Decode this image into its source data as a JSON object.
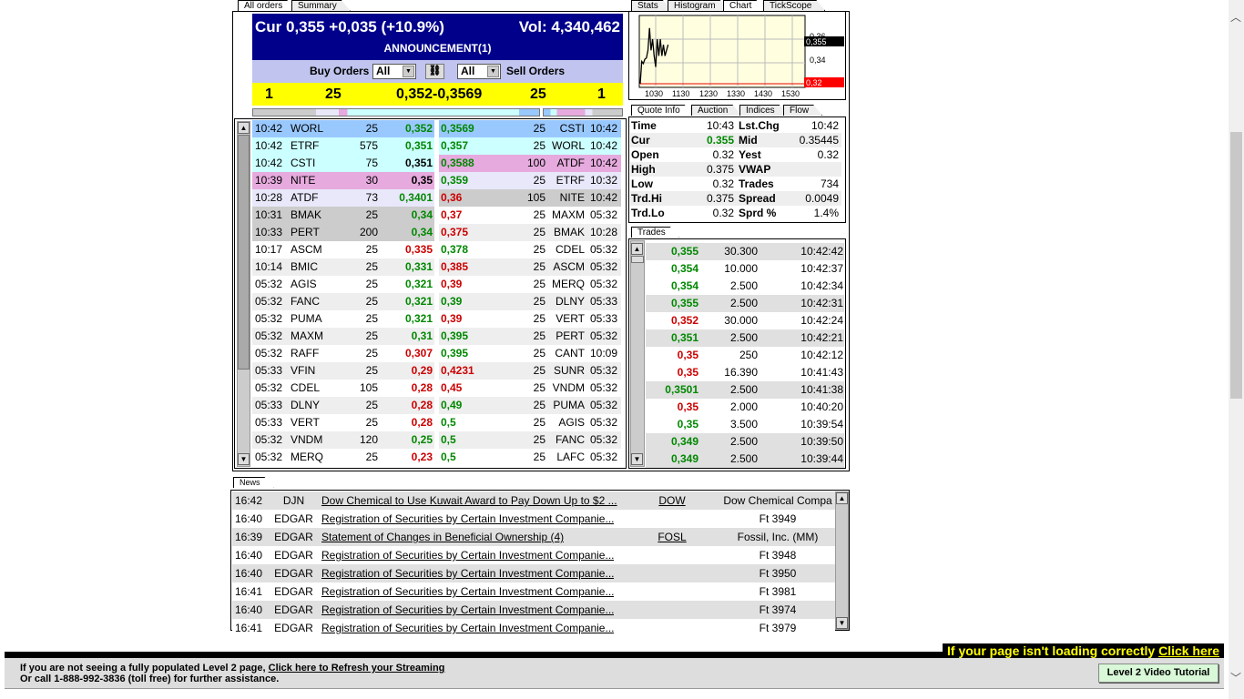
{
  "tabs_left": [
    "All orders",
    "Summary"
  ],
  "tabs_chart": [
    "Stats",
    "Histogram",
    "Chart",
    "TickScope"
  ],
  "tabs_quote": [
    "Quote Info",
    "Auction",
    "Indices",
    "Flow"
  ],
  "tabs_trades": [
    "Trades"
  ],
  "tabs_news": [
    "News"
  ],
  "header": {
    "cur": "Cur 0,355 +0,035 (+10.9%)",
    "vol": "Vol: 4,340,462",
    "announcement": "ANNOUNCEMENT(1)"
  },
  "controls": {
    "buy_label": "Buy Orders",
    "buy_filter": "All",
    "sell_filter": "All",
    "sell_label": "Sell Orders"
  },
  "summary": {
    "bid_count": "1",
    "bid_size": "25",
    "spread": "0,352-0,3569",
    "ask_size": "25",
    "ask_count": "1"
  },
  "book": [
    {
      "bt": "10:42",
      "bm": "WORL",
      "bs": "25",
      "bp": "0,352",
      "bc": "g",
      "bbg": "#99c8ff",
      "ap": "0,3569",
      "ac": "g",
      "as": "25",
      "am": "CSTI",
      "at": "10:42",
      "abg": "#99c8ff"
    },
    {
      "bt": "10:42",
      "bm": "ETRF",
      "bs": "575",
      "bp": "0,351",
      "bc": "g",
      "bbg": "#ccffff",
      "ap": "0,357",
      "ac": "g",
      "as": "25",
      "am": "WORL",
      "at": "10:42",
      "abg": "#ccffff"
    },
    {
      "bt": "10:42",
      "bm": "CSTI",
      "bs": "75",
      "bp": "0,351",
      "bc": "k",
      "bbg": "#ccffff",
      "ap": "0,3588",
      "ac": "g",
      "as": "100",
      "am": "ATDF",
      "at": "10:42",
      "abg": "#e6aade"
    },
    {
      "bt": "10:39",
      "bm": "NITE",
      "bs": "30",
      "bp": "0,35",
      "bc": "k",
      "bbg": "#e6aade",
      "ap": "0,359",
      "ac": "g",
      "as": "25",
      "am": "ETRF",
      "at": "10:32",
      "abg": "#e8e8fa"
    },
    {
      "bt": "10:28",
      "bm": "ATDF",
      "bs": "73",
      "bp": "0,3401",
      "bc": "g",
      "bbg": "#e8e8fa",
      "ap": "0,36",
      "ac": "r",
      "as": "105",
      "am": "NITE",
      "at": "10:42",
      "abg": "#cccccc"
    },
    {
      "bt": "10:31",
      "bm": "BMAK",
      "bs": "25",
      "bp": "0,34",
      "bc": "g",
      "bbg": "#cccccc",
      "ap": "0,37",
      "ac": "r",
      "as": "25",
      "am": "MAXM",
      "at": "05:32",
      "abg": "#ffffff"
    },
    {
      "bt": "10:33",
      "bm": "PERT",
      "bs": "200",
      "bp": "0,34",
      "bc": "g",
      "bbg": "#cccccc",
      "ap": "0,375",
      "ac": "r",
      "as": "25",
      "am": "BMAK",
      "at": "10:28",
      "abg": "#eeeeee"
    },
    {
      "bt": "10:17",
      "bm": "ASCM",
      "bs": "25",
      "bp": "0,335",
      "bc": "r",
      "bbg": "#ffffff",
      "ap": "0,378",
      "ac": "g",
      "as": "25",
      "am": "CDEL",
      "at": "05:32",
      "abg": "#ffffff"
    },
    {
      "bt": "10:14",
      "bm": "BMIC",
      "bs": "25",
      "bp": "0,331",
      "bc": "g",
      "bbg": "#eeeeee",
      "ap": "0,385",
      "ac": "r",
      "as": "25",
      "am": "ASCM",
      "at": "05:32",
      "abg": "#eeeeee"
    },
    {
      "bt": "05:32",
      "bm": "AGIS",
      "bs": "25",
      "bp": "0,321",
      "bc": "g",
      "bbg": "#ffffff",
      "ap": "0,39",
      "ac": "r",
      "as": "25",
      "am": "MERQ",
      "at": "05:32",
      "abg": "#ffffff"
    },
    {
      "bt": "05:32",
      "bm": "FANC",
      "bs": "25",
      "bp": "0,321",
      "bc": "g",
      "bbg": "#eeeeee",
      "ap": "0,39",
      "ac": "g",
      "as": "25",
      "am": "DLNY",
      "at": "05:33",
      "abg": "#eeeeee"
    },
    {
      "bt": "05:32",
      "bm": "PUMA",
      "bs": "25",
      "bp": "0,321",
      "bc": "g",
      "bbg": "#ffffff",
      "ap": "0,39",
      "ac": "r",
      "as": "25",
      "am": "VERT",
      "at": "05:33",
      "abg": "#ffffff"
    },
    {
      "bt": "05:32",
      "bm": "MAXM",
      "bs": "25",
      "bp": "0,31",
      "bc": "g",
      "bbg": "#eeeeee",
      "ap": "0,395",
      "ac": "g",
      "as": "25",
      "am": "PERT",
      "at": "05:32",
      "abg": "#eeeeee"
    },
    {
      "bt": "05:32",
      "bm": "RAFF",
      "bs": "25",
      "bp": "0,307",
      "bc": "r",
      "bbg": "#ffffff",
      "ap": "0,395",
      "ac": "g",
      "as": "25",
      "am": "CANT",
      "at": "10:09",
      "abg": "#ffffff"
    },
    {
      "bt": "05:33",
      "bm": "VFIN",
      "bs": "25",
      "bp": "0,29",
      "bc": "r",
      "bbg": "#eeeeee",
      "ap": "0,4231",
      "ac": "r",
      "as": "25",
      "am": "SUNR",
      "at": "05:32",
      "abg": "#eeeeee"
    },
    {
      "bt": "05:32",
      "bm": "CDEL",
      "bs": "105",
      "bp": "0,28",
      "bc": "r",
      "bbg": "#ffffff",
      "ap": "0,45",
      "ac": "r",
      "as": "25",
      "am": "VNDM",
      "at": "05:32",
      "abg": "#ffffff"
    },
    {
      "bt": "05:33",
      "bm": "DLNY",
      "bs": "25",
      "bp": "0,28",
      "bc": "r",
      "bbg": "#eeeeee",
      "ap": "0,49",
      "ac": "g",
      "as": "25",
      "am": "PUMA",
      "at": "05:32",
      "abg": "#eeeeee"
    },
    {
      "bt": "05:33",
      "bm": "VERT",
      "bs": "25",
      "bp": "0,28",
      "bc": "r",
      "bbg": "#ffffff",
      "ap": "0,5",
      "ac": "g",
      "as": "25",
      "am": "AGIS",
      "at": "05:32",
      "abg": "#ffffff"
    },
    {
      "bt": "05:32",
      "bm": "VNDM",
      "bs": "120",
      "bp": "0,25",
      "bc": "g",
      "bbg": "#eeeeee",
      "ap": "0,5",
      "ac": "g",
      "as": "25",
      "am": "FANC",
      "at": "05:32",
      "abg": "#eeeeee"
    },
    {
      "bt": "05:32",
      "bm": "MERQ",
      "bs": "25",
      "bp": "0,23",
      "bc": "r",
      "bbg": "#ffffff",
      "ap": "0,5",
      "ac": "g",
      "as": "25",
      "am": "LAFC",
      "at": "05:32",
      "abg": "#ffffff"
    }
  ],
  "chart": {
    "x_ticks": [
      "1030",
      "1130",
      "1230",
      "1330",
      "1430",
      "1530"
    ],
    "y_ticks": [
      "0,36",
      "0,34"
    ],
    "current_label": "0,355",
    "yest_label": "0,32",
    "prices": [
      0.32,
      0.34,
      0.338,
      0.342,
      0.343,
      0.35,
      0.37,
      0.35,
      0.36,
      0.345,
      0.335,
      0.36,
      0.345,
      0.36,
      0.345,
      0.355,
      0.345,
      0.35,
      0.355
    ]
  },
  "quote": [
    {
      "l1": "Time",
      "v1": "10:43",
      "c1": "",
      "l2": "Lst.Chg",
      "v2": "10:42"
    },
    {
      "l1": "Cur",
      "v1": "0.355",
      "c1": "g",
      "l2": "Mid",
      "v2": "0.35445"
    },
    {
      "l1": "Open",
      "v1": "0.32",
      "c1": "",
      "l2": "Yest",
      "v2": "0.32"
    },
    {
      "l1": "High",
      "v1": "0.375",
      "c1": "",
      "l2": "VWAP",
      "v2": ""
    },
    {
      "l1": "Low",
      "v1": "0.32",
      "c1": "",
      "l2": "Trades",
      "v2": "734"
    },
    {
      "l1": "Trd.Hi",
      "v1": "0.375",
      "c1": "",
      "l2": "Spread",
      "v2": "0.0049"
    },
    {
      "l1": "Trd.Lo",
      "v1": "0.32",
      "c1": "",
      "l2": "Sprd %",
      "v2": "1.4%"
    }
  ],
  "trades": [
    {
      "p": "0,355",
      "c": "g",
      "s": "30.300",
      "t": "10:42:42",
      "bg": "#e0e0e0"
    },
    {
      "p": "0,354",
      "c": "g",
      "s": "10.000",
      "t": "10:42:37",
      "bg": "#ffffff"
    },
    {
      "p": "0,354",
      "c": "g",
      "s": "2.500",
      "t": "10:42:34",
      "bg": "#ffffff"
    },
    {
      "p": "0,355",
      "c": "g",
      "s": "2.500",
      "t": "10:42:31",
      "bg": "#e0e0e0"
    },
    {
      "p": "0,352",
      "c": "r",
      "s": "30.000",
      "t": "10:42:24",
      "bg": "#ffffff"
    },
    {
      "p": "0,351",
      "c": "g",
      "s": "2.500",
      "t": "10:42:21",
      "bg": "#e0e0e0"
    },
    {
      "p": "0,35",
      "c": "r",
      "s": "250",
      "t": "10:42:12",
      "bg": "#ffffff"
    },
    {
      "p": "0,35",
      "c": "r",
      "s": "16.390",
      "t": "10:41:43",
      "bg": "#ffffff"
    },
    {
      "p": "0,3501",
      "c": "g",
      "s": "2.500",
      "t": "10:41:38",
      "bg": "#e0e0e0"
    },
    {
      "p": "0,35",
      "c": "r",
      "s": "2.000",
      "t": "10:40:20",
      "bg": "#ffffff"
    },
    {
      "p": "0,35",
      "c": "g",
      "s": "3.500",
      "t": "10:39:54",
      "bg": "#ffffff"
    },
    {
      "p": "0,349",
      "c": "g",
      "s": "2.500",
      "t": "10:39:50",
      "bg": "#e0e0e0"
    },
    {
      "p": "0,349",
      "c": "g",
      "s": "2.500",
      "t": "10:39:44",
      "bg": "#e0e0e0"
    }
  ],
  "news": [
    {
      "time": "16:42",
      "src": "DJN",
      "headline": "Dow Chemical to Use Kuwait Award to Pay Down Up to $2 ...",
      "sym": "DOW",
      "co": "Dow Chemical Compa",
      "bg": "#e0e0e0"
    },
    {
      "time": "16:40",
      "src": "EDGAR",
      "headline": "Registration of Securities by Certain Investment Companie...",
      "sym": "",
      "co": "Ft 3949",
      "bg": "#ffffff"
    },
    {
      "time": "16:39",
      "src": "EDGAR",
      "headline": "Statement of Changes in Beneficial Ownership (4)",
      "sym": "FOSL",
      "co": "Fossil, Inc. (MM)",
      "bg": "#e0e0e0"
    },
    {
      "time": "16:40",
      "src": "EDGAR",
      "headline": "Registration of Securities by Certain Investment Companie...",
      "sym": "",
      "co": "Ft 3948",
      "bg": "#ffffff"
    },
    {
      "time": "16:40",
      "src": "EDGAR",
      "headline": "Registration of Securities by Certain Investment Companie...",
      "sym": "",
      "co": "Ft 3950",
      "bg": "#e0e0e0"
    },
    {
      "time": "16:41",
      "src": "EDGAR",
      "headline": "Registration of Securities by Certain Investment Companie...",
      "sym": "",
      "co": "Ft 3981",
      "bg": "#ffffff"
    },
    {
      "time": "16:40",
      "src": "EDGAR",
      "headline": "Registration of Securities by Certain Investment Companie...",
      "sym": "",
      "co": "Ft 3974",
      "bg": "#e0e0e0"
    },
    {
      "time": "16:41",
      "src": "EDGAR",
      "headline": "Registration of Securities by Certain Investment Companie...",
      "sym": "",
      "co": "Ft 3979",
      "bg": "#ffffff"
    }
  ],
  "footer": {
    "warning": "If your page isn't loading correctly ",
    "warning_link": "Click here",
    "line1": "If you are not seeing a fully populated Level 2 page, ",
    "refresh_link": "Click here to Refresh your Streaming",
    "line2": "Or call 1-888-992-3836 (toll free) for further assistance.",
    "tutorial_button": "Level 2 Video Tutorial"
  }
}
